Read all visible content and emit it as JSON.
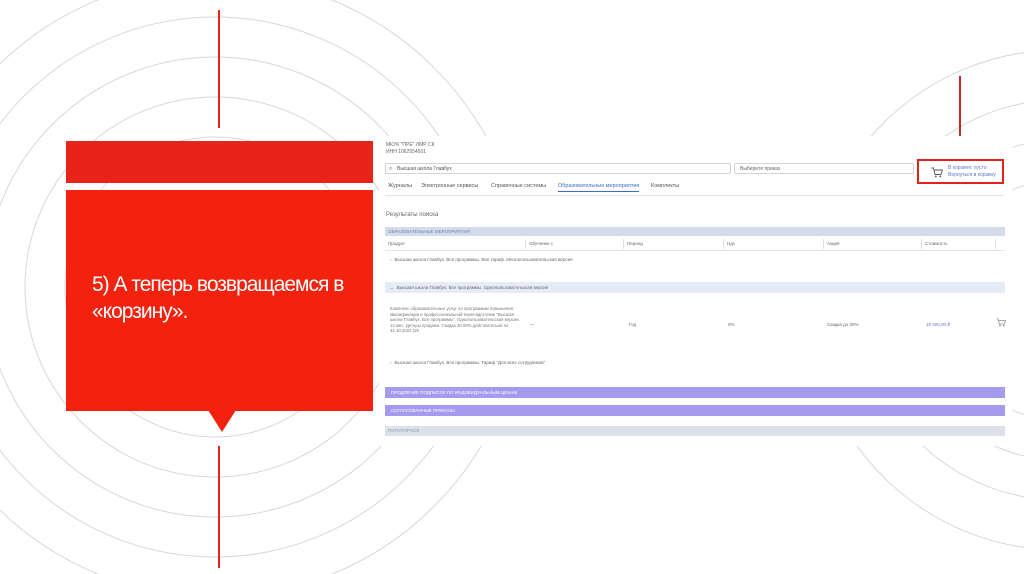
{
  "slide": {
    "title": "5) А теперь возвращаемся в «корзину».",
    "accent_color": "#f2220e"
  },
  "screenshot": {
    "org_name": "МКУК \"ПРЕ\" ЛМР СК",
    "inn": "ИНН 1062554501",
    "search": {
      "value": "Высшая школа Главбух",
      "icon": "search-icon"
    },
    "price_select": {
      "value": "Выберите приказ"
    },
    "cart": {
      "line1": "В корзине: пусто",
      "line2": "Вернуться в корзину",
      "icon": "cart-icon"
    },
    "tabs": [
      {
        "label": "Журналы",
        "active": false
      },
      {
        "label": "Электронные сервисы",
        "active": false
      },
      {
        "label": "Справочные системы",
        "active": false
      },
      {
        "label": "Образовательные мероприятия",
        "active": true
      },
      {
        "label": "Комплекты",
        "active": false
      }
    ],
    "results_title": "Результаты поиска",
    "section_header": "ОБРАЗОВАТЕЛЬНЫЕ МЕРОПРИЯТИЯ",
    "columns": [
      "Продукт",
      "Обучение с",
      "Период",
      "Ндс",
      "Акция",
      "Стоимость"
    ],
    "rows": [
      {
        "label": "Высшая школа Главбух. Все программы. Вип тариф. Многопользовательская версия",
        "expanded": false
      },
      {
        "label": "Высшая школа Главбух. Все программы. Однопользовательская версия",
        "expanded": true
      },
      {
        "label": "Высшая школа Главбух. Все программы. Тариф \"Для всех сотрудников\"",
        "expanded": false
      }
    ],
    "detail": {
      "description": "Комплекс образовательных услуг по программам повышения квалификации и профессиональной переподготовки \"Высшая школа Главбух. Все программы\". Однопользовательская версия. 12 мес. Детеры продажа. Скидка 30.00% действительна по 31.10.2023 (25",
      "start": "—",
      "period": "Год",
      "vat": "0%",
      "promo": "Скидка до 30%",
      "price": "19 300,00 ₽"
    },
    "bars": {
      "renewal": "ПРОДЛЕНИЕ ПОДПИСОК ПО ИНДИВИДУАЛЬНЫМ ЦЕНАМ",
      "agreed": "СОГЛАСОВАННЫЕ ПРИКАЗЫ",
      "popular": "ПОПУЛЯРНОЕ"
    }
  }
}
